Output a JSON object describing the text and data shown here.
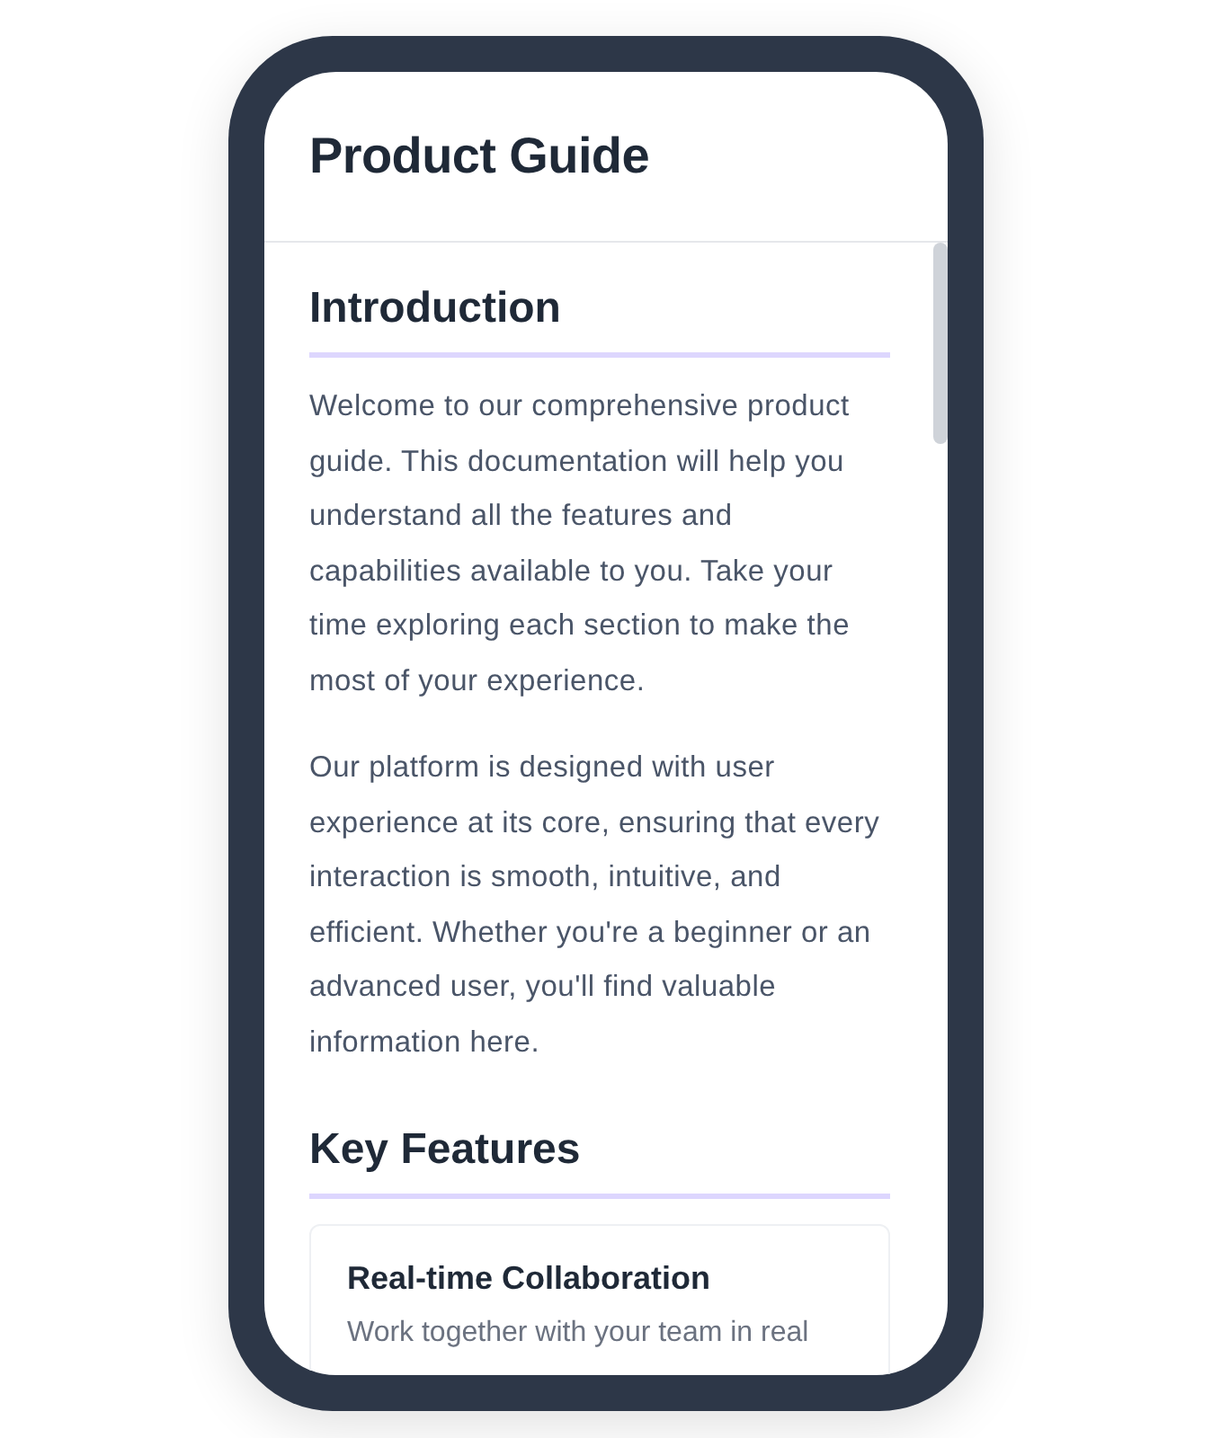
{
  "header": {
    "title": "Product Guide"
  },
  "sections": [
    {
      "heading": "Introduction",
      "paragraphs": [
        "Welcome to our comprehensive product guide. This documentation will help you understand all the features and capabilities available to you. Take your time exploring each section to make the most of your experience.",
        "Our platform is designed with user experience at its core, ensuring that every interaction is smooth, intuitive, and efficient. Whether you're a beginner or an advanced user, you'll find valuable information here."
      ]
    },
    {
      "heading": "Key Features",
      "cards": [
        {
          "title": "Real-time Collaboration",
          "description": "Work together with your team in real"
        }
      ]
    }
  ]
}
